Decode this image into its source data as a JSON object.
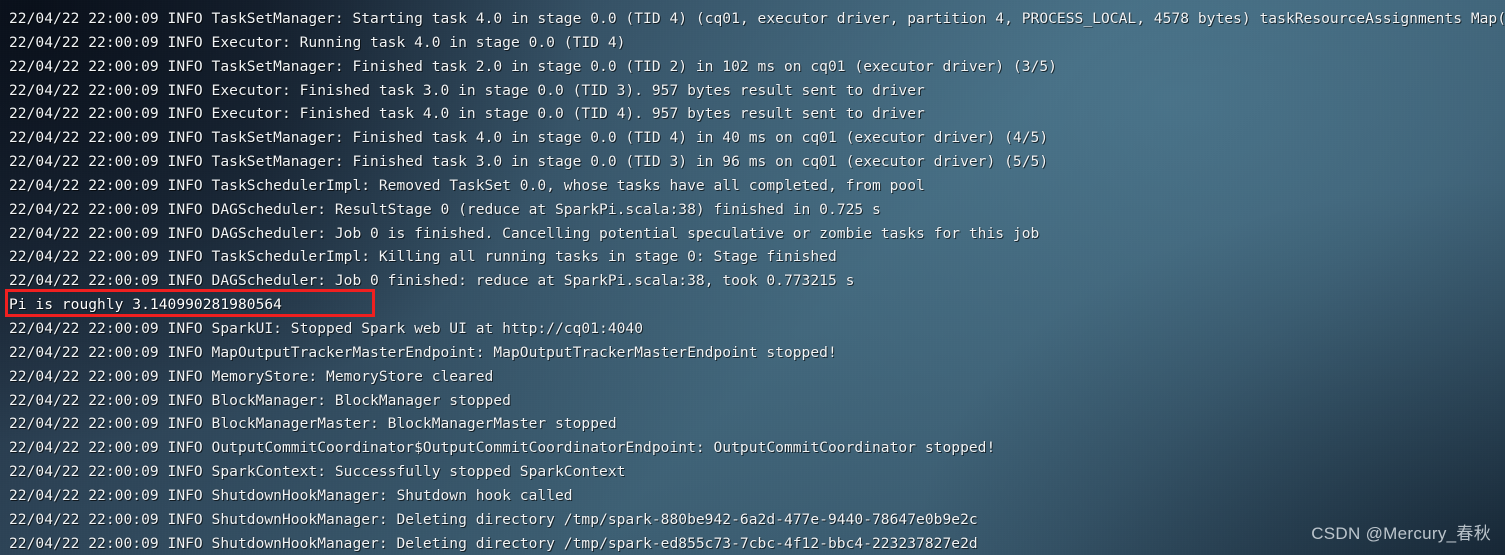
{
  "terminal": {
    "app": "spark-submit console output",
    "colors": {
      "background_top_left": "#1d2838",
      "background_mid": "#3d5f73",
      "background_bottom_right": "#24394b",
      "text": "#f2f5f7",
      "highlight_border": "#f02020"
    },
    "lines": [
      {
        "text": "22/04/22 22:00:09 INFO TaskSetManager: Starting task 4.0 in stage 0.0 (TID 4) (cq01, executor driver, partition 4, PROCESS_LOCAL, 4578 bytes) taskResourceAssignments Map()",
        "highlighted": false
      },
      {
        "text": "22/04/22 22:00:09 INFO Executor: Running task 4.0 in stage 0.0 (TID 4)",
        "highlighted": false
      },
      {
        "text": "22/04/22 22:00:09 INFO TaskSetManager: Finished task 2.0 in stage 0.0 (TID 2) in 102 ms on cq01 (executor driver) (3/5)",
        "highlighted": false
      },
      {
        "text": "22/04/22 22:00:09 INFO Executor: Finished task 3.0 in stage 0.0 (TID 3). 957 bytes result sent to driver",
        "highlighted": false
      },
      {
        "text": "22/04/22 22:00:09 INFO Executor: Finished task 4.0 in stage 0.0 (TID 4). 957 bytes result sent to driver",
        "highlighted": false
      },
      {
        "text": "22/04/22 22:00:09 INFO TaskSetManager: Finished task 4.0 in stage 0.0 (TID 4) in 40 ms on cq01 (executor driver) (4/5)",
        "highlighted": false
      },
      {
        "text": "22/04/22 22:00:09 INFO TaskSetManager: Finished task 3.0 in stage 0.0 (TID 3) in 96 ms on cq01 (executor driver) (5/5)",
        "highlighted": false
      },
      {
        "text": "22/04/22 22:00:09 INFO TaskSchedulerImpl: Removed TaskSet 0.0, whose tasks have all completed, from pool",
        "highlighted": false
      },
      {
        "text": "22/04/22 22:00:09 INFO DAGScheduler: ResultStage 0 (reduce at SparkPi.scala:38) finished in 0.725 s",
        "highlighted": false
      },
      {
        "text": "22/04/22 22:00:09 INFO DAGScheduler: Job 0 is finished. Cancelling potential speculative or zombie tasks for this job",
        "highlighted": false
      },
      {
        "text": "22/04/22 22:00:09 INFO TaskSchedulerImpl: Killing all running tasks in stage 0: Stage finished",
        "highlighted": false
      },
      {
        "text": "22/04/22 22:00:09 INFO DAGScheduler: Job 0 finished: reduce at SparkPi.scala:38, took 0.773215 s",
        "highlighted": false
      },
      {
        "text": "Pi is roughly 3.140990281980564",
        "highlighted": true
      },
      {
        "text": "22/04/22 22:00:09 INFO SparkUI: Stopped Spark web UI at http://cq01:4040",
        "highlighted": false
      },
      {
        "text": "22/04/22 22:00:09 INFO MapOutputTrackerMasterEndpoint: MapOutputTrackerMasterEndpoint stopped!",
        "highlighted": false
      },
      {
        "text": "22/04/22 22:00:09 INFO MemoryStore: MemoryStore cleared",
        "highlighted": false
      },
      {
        "text": "22/04/22 22:00:09 INFO BlockManager: BlockManager stopped",
        "highlighted": false
      },
      {
        "text": "22/04/22 22:00:09 INFO BlockManagerMaster: BlockManagerMaster stopped",
        "highlighted": false
      },
      {
        "text": "22/04/22 22:00:09 INFO OutputCommitCoordinator$OutputCommitCoordinatorEndpoint: OutputCommitCoordinator stopped!",
        "highlighted": false
      },
      {
        "text": "22/04/22 22:00:09 INFO SparkContext: Successfully stopped SparkContext",
        "highlighted": false
      },
      {
        "text": "22/04/22 22:00:09 INFO ShutdownHookManager: Shutdown hook called",
        "highlighted": false
      },
      {
        "text": "22/04/22 22:00:09 INFO ShutdownHookManager: Deleting directory /tmp/spark-880be942-6a2d-477e-9440-78647e0b9e2c",
        "highlighted": false
      },
      {
        "text": "22/04/22 22:00:09 INFO ShutdownHookManager: Deleting directory /tmp/spark-ed855c73-7cbc-4f12-bbc4-223237827e2d",
        "highlighted": false
      }
    ]
  },
  "watermark": {
    "text": "CSDN @Mercury_春秋"
  }
}
